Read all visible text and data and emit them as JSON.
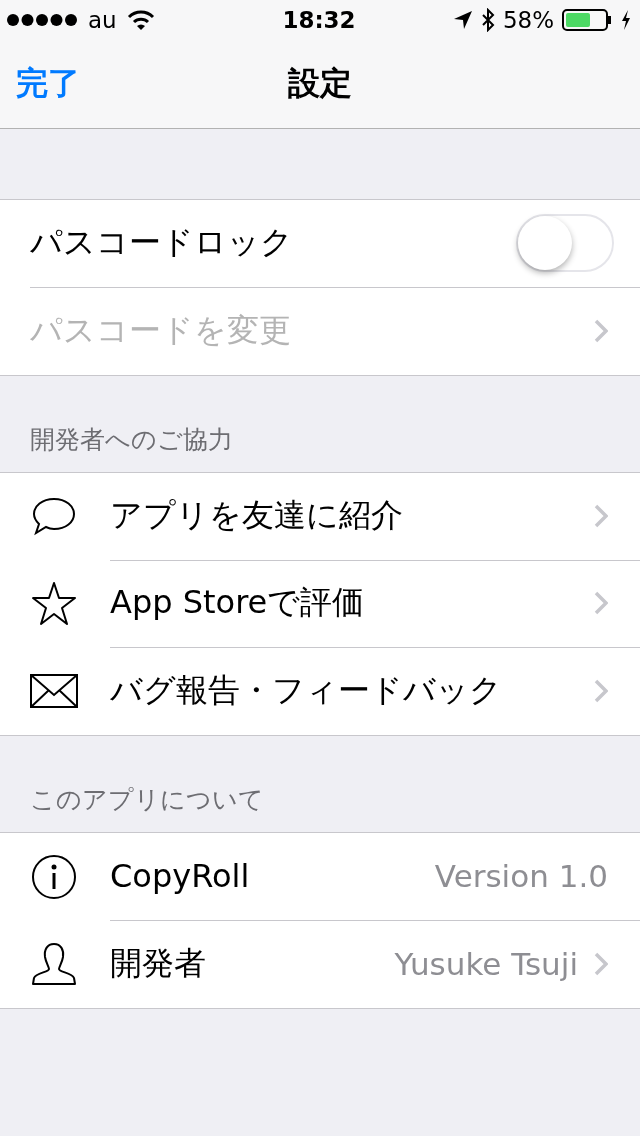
{
  "status_bar": {
    "carrier": "au",
    "time": "18:32",
    "battery": "58%"
  },
  "nav": {
    "left_button": "完了",
    "title": "設定"
  },
  "sections": [
    {
      "rows": [
        {
          "kind": "toggle",
          "label": "パスコードロック",
          "on": false
        },
        {
          "kind": "link",
          "label": "パスコードを変更",
          "disabled": true
        }
      ]
    },
    {
      "header": "開発者へのご協力",
      "rows": [
        {
          "kind": "link",
          "label": "アプリを友達に紹介",
          "disabled": false
        },
        {
          "kind": "link",
          "label": "App Storeで評価",
          "disabled": false
        },
        {
          "kind": "link",
          "label": "バグ報告・フィードバック",
          "disabled": false
        }
      ]
    },
    {
      "header": "このアプリについて",
      "rows": [
        {
          "kind": "value",
          "label": "CopyRoll",
          "detail": "Version 1.0"
        },
        {
          "kind": "link",
          "label": "開発者",
          "detail": "Yusuke Tsuji",
          "disabled": false
        }
      ]
    }
  ]
}
